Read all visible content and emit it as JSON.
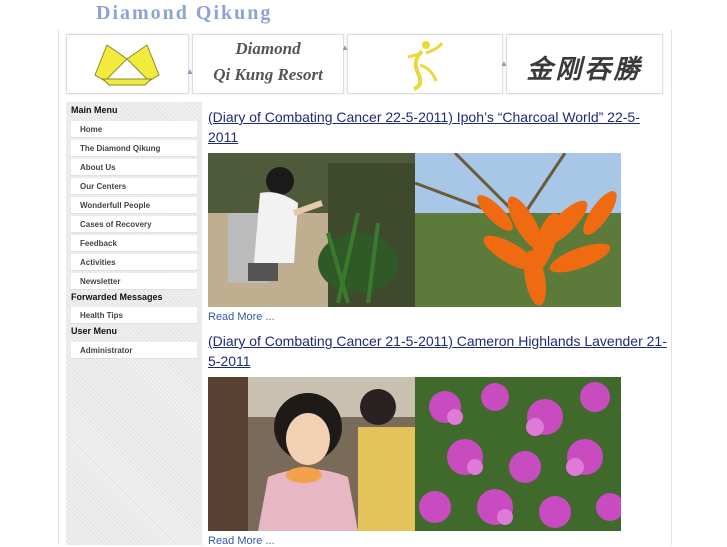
{
  "site": {
    "title": "Diamond Qikung"
  },
  "banner": {
    "resort_line1": "Diamond",
    "resort_line2": "Qi Kung Resort",
    "chinese_title": "金刚吞勝"
  },
  "sidebar": {
    "main_menu_heading": "Main Menu",
    "main_items": [
      {
        "label": "Home"
      },
      {
        "label": "The Diamond Qikung"
      },
      {
        "label": "About Us"
      },
      {
        "label": "Our Centers"
      },
      {
        "label": "Wonderfull People"
      },
      {
        "label": "Cases of Recovery"
      },
      {
        "label": "Feedback"
      },
      {
        "label": "Activities"
      },
      {
        "label": "Newsletter"
      }
    ],
    "forwarded_heading": "Forwarded Messages",
    "forwarded_items": [
      {
        "label": "Health Tips"
      }
    ],
    "user_menu_heading": "User Menu",
    "user_items": [
      {
        "label": "Administrator"
      }
    ]
  },
  "articles": [
    {
      "title": "(Diary of Combating Cancer 22-5-2011) Ipoh’s “Charcoal World”    22-5-2011        ",
      "read_more": "Read More ..."
    },
    {
      "title": "(Diary of Combating Cancer 21-5-2011) Cameron Highlands Lavender       21-5-2011        ",
      "read_more": "Read More ..."
    }
  ],
  "colors": {
    "title_blue": "#8da3d6",
    "link_blue": "#1d2a78",
    "hand_yellow": "#f2ea3c",
    "flower_orange": "#f06a12",
    "lavender_pink": "#c84bc0"
  }
}
